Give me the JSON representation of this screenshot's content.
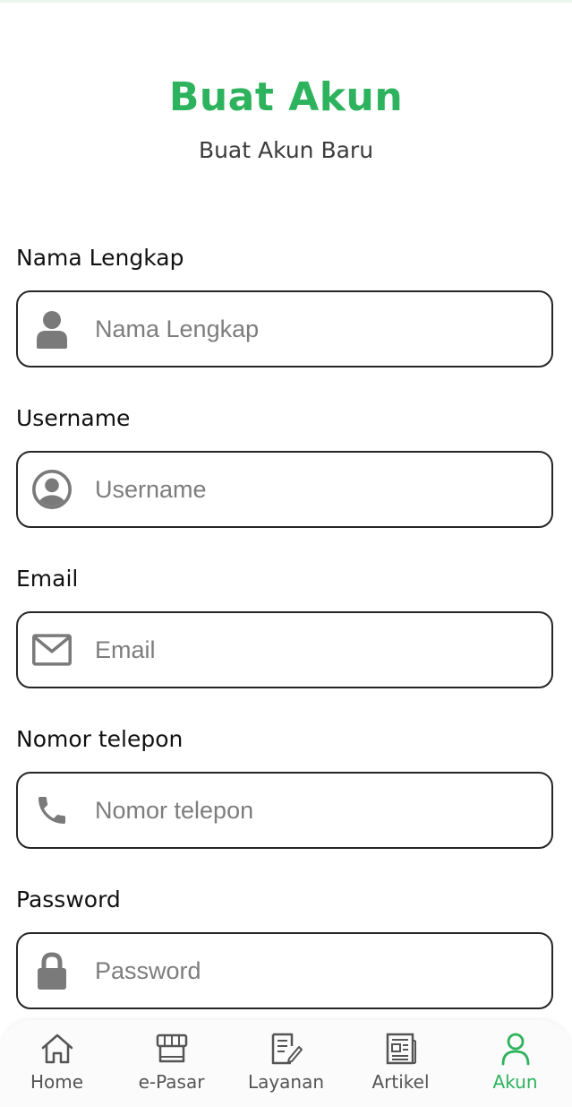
{
  "header": {
    "title": "Buat Akun",
    "subtitle": "Buat Akun Baru"
  },
  "form": {
    "fields": [
      {
        "label": "Nama Lengkap",
        "placeholder": "Nama Lengkap",
        "value": "",
        "icon": "person-icon"
      },
      {
        "label": "Username",
        "placeholder": "Username",
        "value": "",
        "icon": "account-circle-icon"
      },
      {
        "label": "Email",
        "placeholder": "Email",
        "value": "",
        "icon": "envelope-icon"
      },
      {
        "label": "Nomor telepon",
        "placeholder": "Nomor telepon",
        "value": "",
        "icon": "phone-icon"
      },
      {
        "label": "Password",
        "placeholder": "Password",
        "value": "",
        "icon": "lock-icon"
      }
    ]
  },
  "nav": {
    "items": [
      {
        "label": "Home",
        "icon": "home-icon",
        "active": false
      },
      {
        "label": "e-Pasar",
        "icon": "store-icon",
        "active": false
      },
      {
        "label": "Layanan",
        "icon": "document-edit-icon",
        "active": false
      },
      {
        "label": "Artikel",
        "icon": "newspaper-icon",
        "active": false
      },
      {
        "label": "Akun",
        "icon": "user-icon",
        "active": true
      }
    ]
  },
  "colors": {
    "accent": "#2db35d",
    "icon_gray": "#7a7a7a",
    "border": "#262626"
  }
}
